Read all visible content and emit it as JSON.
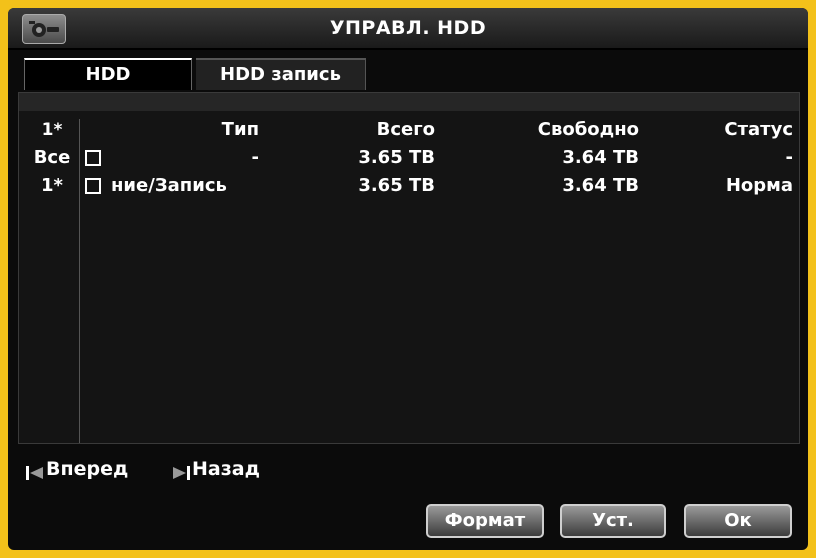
{
  "window": {
    "title": "УПРАВЛ. HDD",
    "icon": "hdd-manage-icon"
  },
  "tabs": [
    {
      "label": "HDD",
      "active": true
    },
    {
      "label": "HDD запись",
      "active": false
    }
  ],
  "table": {
    "columns": {
      "index": "1*",
      "type": "Тип",
      "total": "Всего",
      "free": "Свободно",
      "status": "Статус"
    },
    "rows": [
      {
        "index": "Все",
        "checked": false,
        "type": "-",
        "total": "3.65 TB",
        "free": "3.64 TB",
        "status": "-"
      },
      {
        "index": "1*",
        "checked": false,
        "type": "ние/Запись",
        "total": "3.65 TB",
        "free": "3.64 TB",
        "status": "Норма"
      }
    ]
  },
  "nav": {
    "prev_label": "Вперед",
    "next_label": "Назад"
  },
  "buttons": {
    "format": "Формат",
    "set": "Уст.",
    "ok": "Ок"
  },
  "colors": {
    "frame": "#f3c11a",
    "background": "#0b0b0b",
    "text": "#ffffff"
  }
}
